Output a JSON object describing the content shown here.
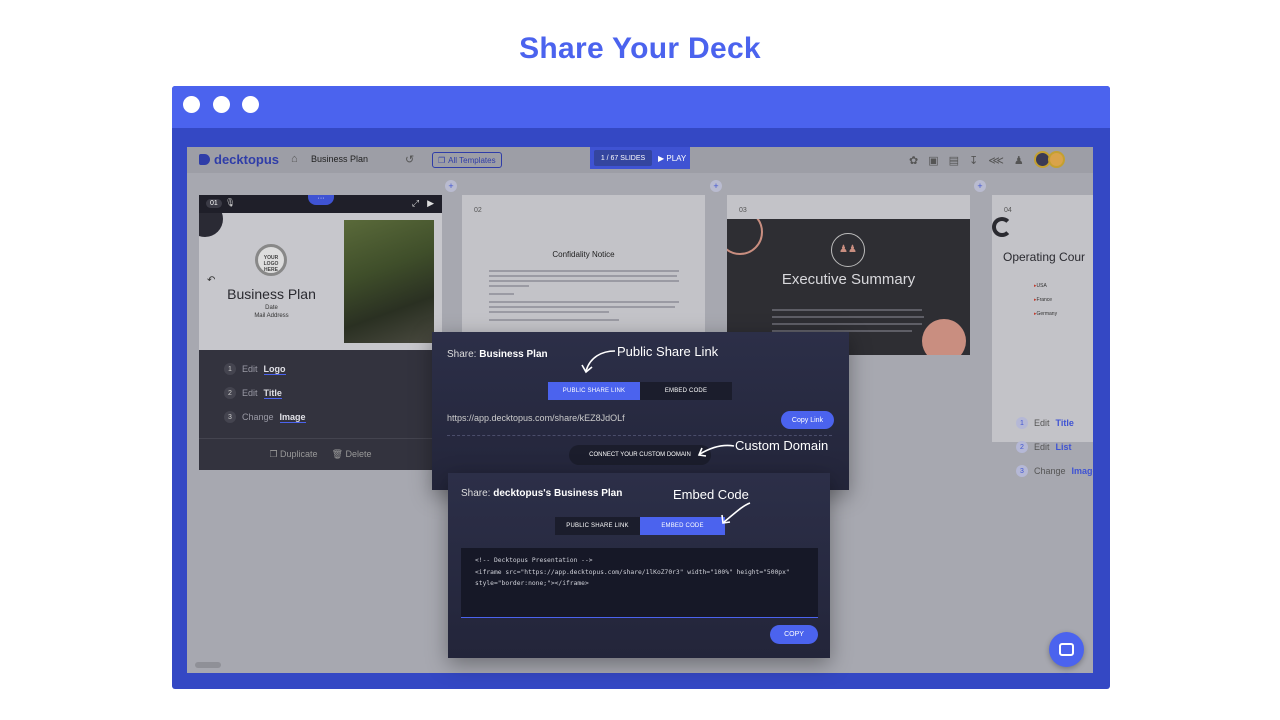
{
  "page": {
    "title": "Share Your Deck"
  },
  "app": {
    "logo": "decktopus",
    "deck_name": "Business Plan",
    "all_templates": "All Templates",
    "slide_counter": "1 / 67 SLIDES",
    "play": "PLAY",
    "colors": {
      "accent": "#4b63ee",
      "frame": "#3448c4"
    }
  },
  "slides": {
    "s1": {
      "number": "01",
      "logo_text": "YOUR LOGO HERE",
      "title": "Business Plan",
      "date": "Date",
      "address": "Mail Address",
      "edits": [
        {
          "n": "1",
          "verb": "Edit",
          "target": "Logo"
        },
        {
          "n": "2",
          "verb": "Edit",
          "target": "Title"
        },
        {
          "n": "3",
          "verb": "Change",
          "target": "Image"
        }
      ],
      "duplicate": "Duplicate",
      "delete": "Delete"
    },
    "s2": {
      "number": "02",
      "title": "Confidality Notice"
    },
    "s3": {
      "number": "03",
      "title": "Executive Summary"
    },
    "s4": {
      "number": "04",
      "title": "Operating Cour",
      "bullets": [
        "USA",
        "France",
        "Germany"
      ],
      "edits": [
        {
          "n": "1",
          "verb": "Edit",
          "target": "Title"
        },
        {
          "n": "2",
          "verb": "Edit",
          "target": "List"
        },
        {
          "n": "3",
          "verb": "Change",
          "target": "Image"
        }
      ]
    }
  },
  "share_link": {
    "title_prefix": "Share:",
    "title_name": "Business Plan",
    "tab_public": "PUBLIC SHARE LINK",
    "tab_embed": "EMBED CODE",
    "url": "https://app.decktopus.com/share/kEZ8JdOLf",
    "copy_link": "Copy Link",
    "custom_domain": "CONNECT YOUR CUSTOM DOMAIN"
  },
  "share_embed": {
    "title_prefix": "Share:",
    "title_name": "decktopus's Business Plan",
    "tab_public": "PUBLIC SHARE LINK",
    "tab_embed": "EMBED CODE",
    "code": "<!-- Decktopus Presentation -->\n<iframe src=\"https://app.decktopus.com/share/1lKoZ70r3\" width=\"100%\" height=\"500px\"\nstyle=\"border:none;\"></iframe>",
    "copy": "COPY"
  },
  "annotations": {
    "public_share_link": "Public Share Link",
    "custom_domain": "Custom Domain",
    "embed_code": "Embed Code"
  }
}
